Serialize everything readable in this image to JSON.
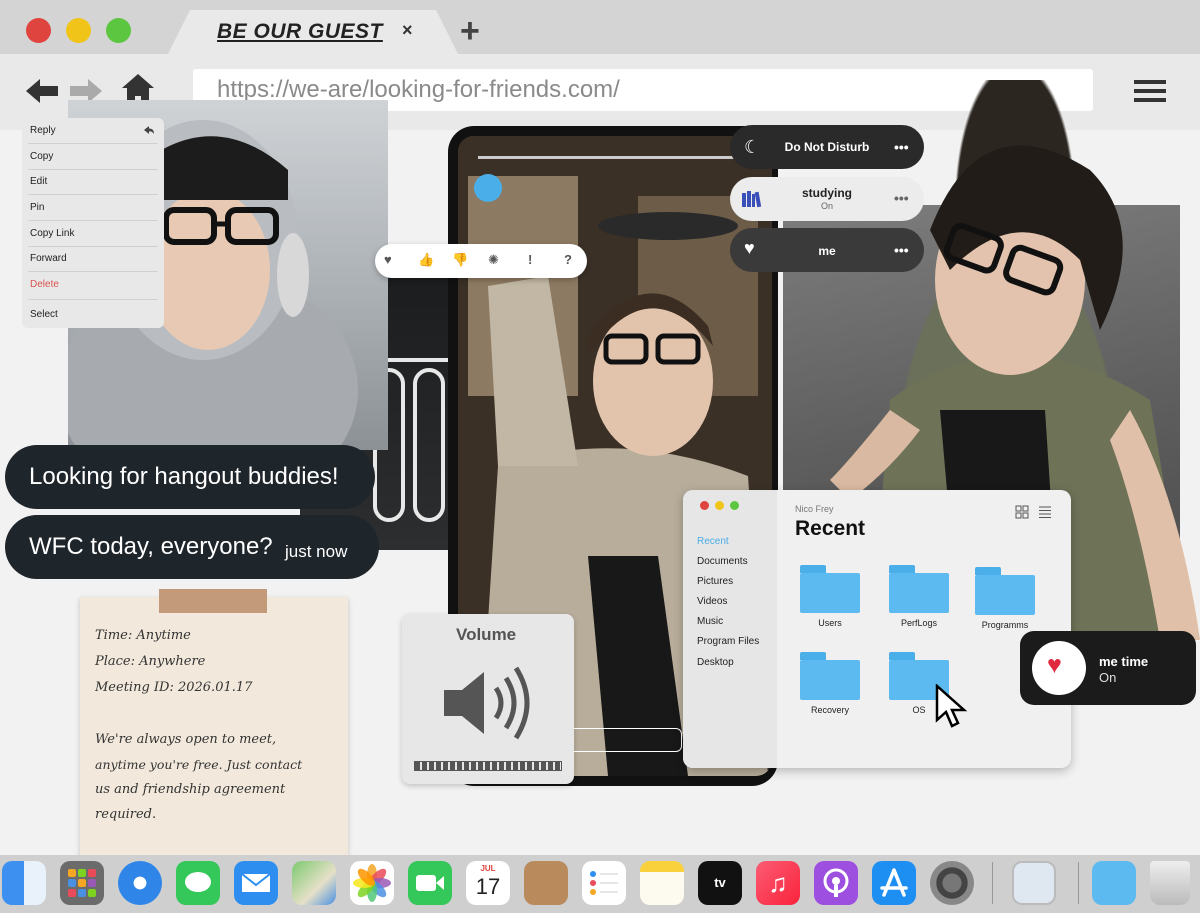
{
  "browser": {
    "tab_title": "BE OUR GUEST",
    "tab_close": "×",
    "new_tab": "+",
    "url": "https://we-are/looking-for-friends.com/"
  },
  "context_menu": {
    "items": [
      "Reply",
      "Copy",
      "Edit",
      "Pin",
      "Copy Link",
      "Forward",
      "Delete",
      "Select"
    ]
  },
  "status_pills": [
    {
      "title": "Do Not Disturb",
      "sub": "",
      "dots": "•••",
      "icon": "moon-icon"
    },
    {
      "title": "studying",
      "sub": "On",
      "dots": "•••",
      "icon": "books-icon"
    },
    {
      "title": "me",
      "sub": "",
      "dots": "•••",
      "icon": "heart-icon"
    }
  ],
  "chat": {
    "bubble1": "Looking for hangout buddies!",
    "bubble2": "WFC today, everyone?",
    "bubble2_time": "just now"
  },
  "note": {
    "lines": [
      "Time: Anytime",
      "Place: Anywhere",
      "Meeting ID: 2026.01.17",
      "We're always open to meet,",
      "anytime you're free. Just contact",
      "us and friendship agreement",
      "required."
    ]
  },
  "volume": {
    "label": "Volume"
  },
  "finder": {
    "user": "Nico Frey",
    "title": "Recent",
    "sidebar": [
      "Recent",
      "Documents",
      "Pictures",
      "Videos",
      "Music",
      "Program Files",
      "Desktop"
    ],
    "folders": [
      "Users",
      "PerfLogs",
      "Programms",
      "Recovery",
      "OS"
    ]
  },
  "me_time": {
    "title": "me time",
    "status": "On"
  },
  "dock": {
    "calendar_day": "17",
    "calendar_month": "JUL",
    "tv_label": "tv"
  },
  "colors": {
    "accent": "#4aaee8",
    "note": "#f2e9dc",
    "bubble": "#1e252b",
    "delete": "#d9534f"
  }
}
